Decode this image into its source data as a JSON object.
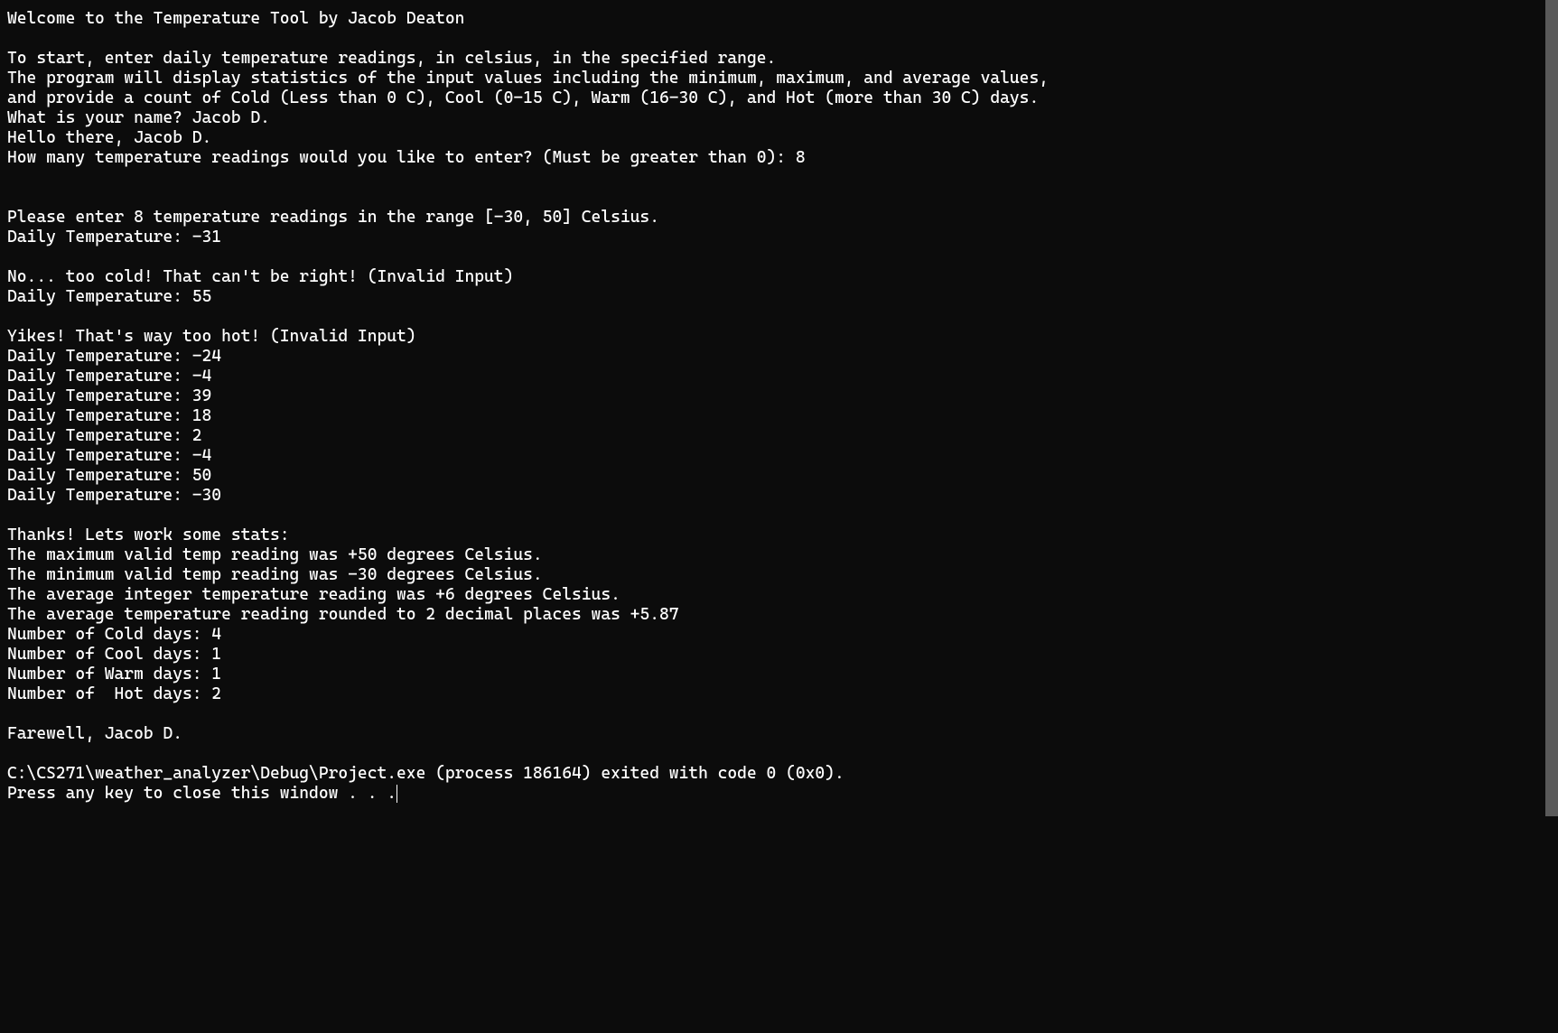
{
  "lines": [
    "Welcome to the Temperature Tool by Jacob Deaton",
    "",
    "To start, enter daily temperature readings, in celsius, in the specified range.",
    "The program will display statistics of the input values including the minimum, maximum, and average values,",
    "and provide a count of Cold (Less than 0 C), Cool (0-15 C), Warm (16-30 C), and Hot (more than 30 C) days.",
    "What is your name? Jacob D.",
    "Hello there, Jacob D.",
    "How many temperature readings would you like to enter? (Must be greater than 0): 8",
    "",
    "",
    "Please enter 8 temperature readings in the range [-30, 50] Celsius.",
    "Daily Temperature: -31",
    "",
    "No... too cold! That can't be right! (Invalid Input)",
    "Daily Temperature: 55",
    "",
    "Yikes! That's way too hot! (Invalid Input)",
    "Daily Temperature: -24",
    "Daily Temperature: -4",
    "Daily Temperature: 39",
    "Daily Temperature: 18",
    "Daily Temperature: 2",
    "Daily Temperature: -4",
    "Daily Temperature: 50",
    "Daily Temperature: -30",
    "",
    "Thanks! Lets work some stats:",
    "The maximum valid temp reading was +50 degrees Celsius.",
    "The minimum valid temp reading was -30 degrees Celsius.",
    "The average integer temperature reading was +6 degrees Celsius.",
    "The average temperature reading rounded to 2 decimal places was +5.87",
    "Number of Cold days: 4",
    "Number of Cool days: 1",
    "Number of Warm days: 1",
    "Number of  Hot days: 2",
    "",
    "Farewell, Jacob D.",
    "",
    "C:\\CS271\\weather_analyzer\\Debug\\Project.exe (process 186164) exited with code 0 (0x0).",
    "Press any key to close this window . . ."
  ],
  "colors": {
    "bg": "#0c0c0c",
    "fg": "#ffffff"
  }
}
